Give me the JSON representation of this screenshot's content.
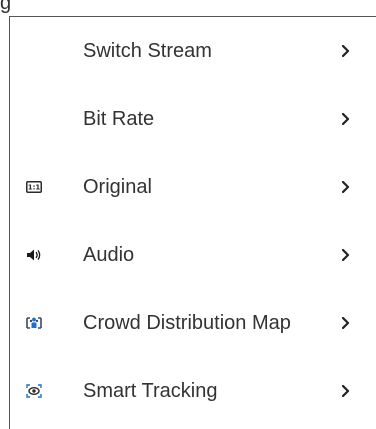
{
  "partial_top_text": "g",
  "menu": {
    "items": [
      {
        "label": "Switch Stream",
        "icon": "none",
        "chevron": "chevron-right-icon"
      },
      {
        "label": "Bit Rate",
        "icon": "none",
        "chevron": "chevron-right-icon"
      },
      {
        "label": "Original",
        "icon": "original-size-icon",
        "icon_text": "1:1",
        "chevron": "chevron-right-icon"
      },
      {
        "label": "Audio",
        "icon": "speaker-icon",
        "chevron": "chevron-right-icon"
      },
      {
        "label": "Crowd Distribution Map",
        "icon": "crowd-map-icon",
        "chevron": "chevron-right-icon"
      },
      {
        "label": "Smart Tracking",
        "icon": "smart-tracking-icon",
        "chevron": "chevron-right-icon"
      }
    ]
  },
  "colors": {
    "text": "#333333",
    "border": "#555555",
    "background": "#ffffff",
    "icon": "#2b2b2b",
    "accent_blue": "#1f6fd1"
  }
}
